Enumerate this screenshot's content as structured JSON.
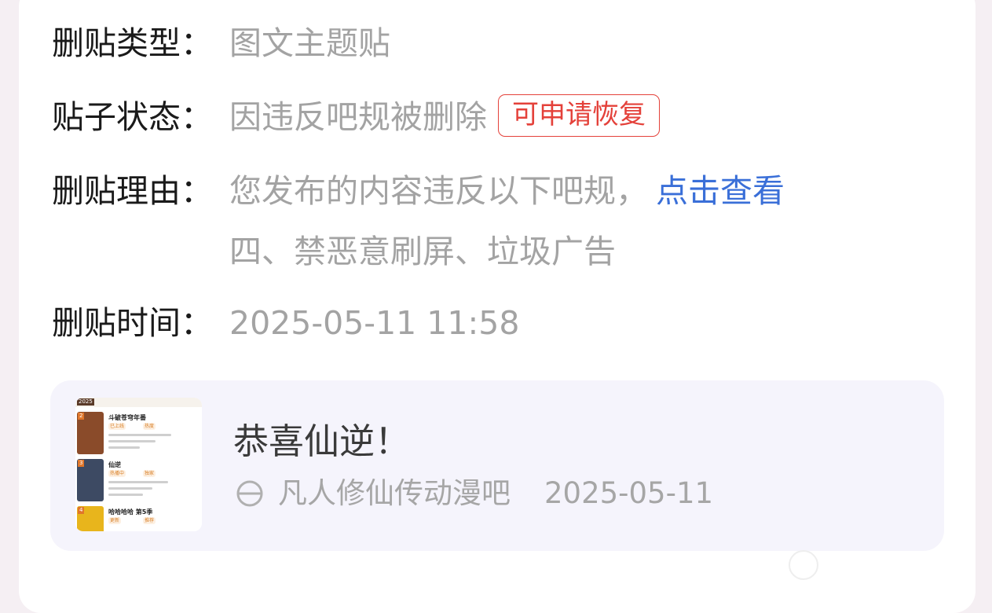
{
  "details": {
    "type_label": "删贴类型：",
    "type_value": "图文主题贴",
    "status_label": "贴子状态：",
    "status_value": "因违反吧规被删除",
    "status_badge": "可申请恢复",
    "reason_label": "删贴理由：",
    "reason_text": "您发布的内容违反以下吧规，",
    "reason_link": "点击查看",
    "reason_rule": "四、禁恶意刷屏、垃圾广告",
    "time_label": "删贴时间：",
    "time_value": "2025-05-11 11:58"
  },
  "post": {
    "title": "恭喜仙逆！",
    "forum": "凡人修仙传动漫吧",
    "date": "2025-05-11",
    "thumbnail": {
      "header": "2025",
      "items": [
        {
          "rank": "2",
          "title": "斗破苍穹年番",
          "tags": [
            "已上线",
            "热度"
          ],
          "cover_color": "#8a4b2a"
        },
        {
          "rank": "3",
          "title": "仙逆",
          "tags": [
            "热播中",
            "独家"
          ],
          "cover_color": "#3d4a63"
        },
        {
          "rank": "4",
          "title": "哈哈哈哈 第5季",
          "tags": [
            "更新",
            "推荐"
          ],
          "cover_color": "#e8b51c"
        }
      ]
    }
  },
  "colors": {
    "accent_red": "#e4413a",
    "link_blue": "#3a6fd8",
    "muted_text": "#a3a3a3"
  }
}
